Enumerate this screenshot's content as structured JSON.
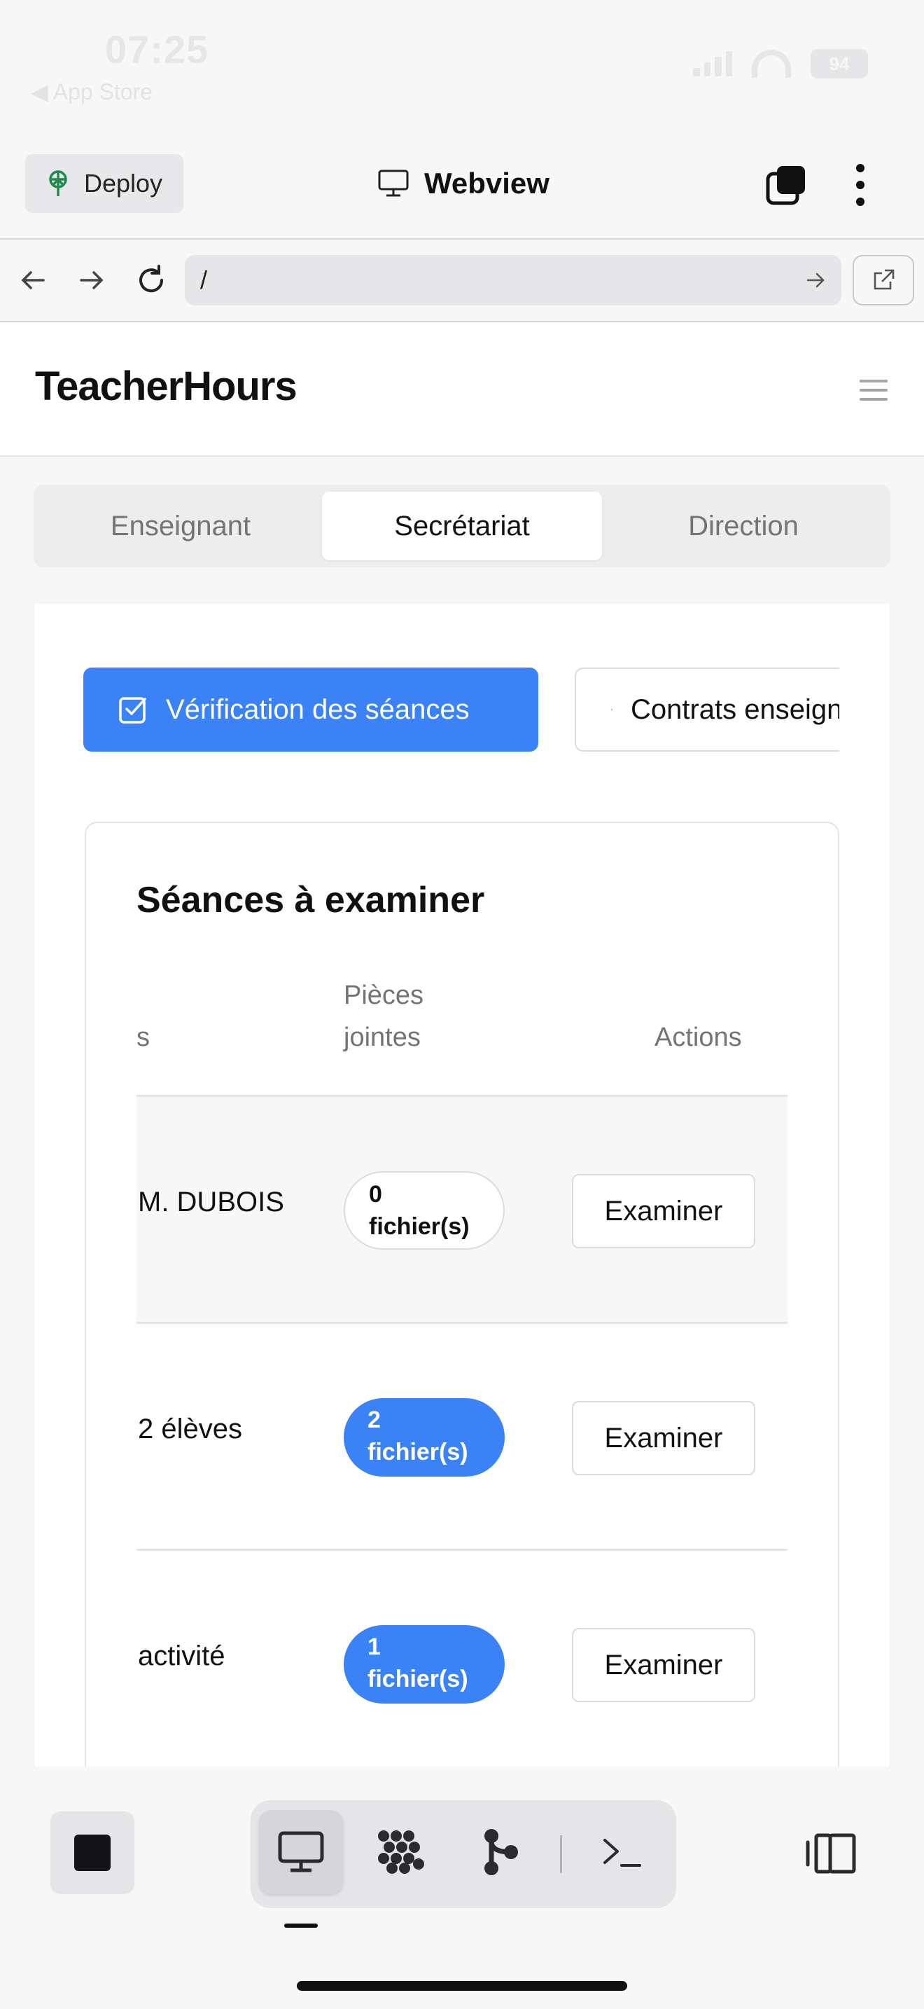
{
  "status_bar": {
    "time": "07:25",
    "back_label": "◀ App Store",
    "battery": "94"
  },
  "replit_bar": {
    "deploy_label": "Deploy",
    "title": "Webview"
  },
  "browser": {
    "url": "/"
  },
  "app": {
    "brand": "TeacherHours",
    "role_tabs": [
      {
        "label": "Enseignant",
        "active": false
      },
      {
        "label": "Secrétariat",
        "active": true
      },
      {
        "label": "Direction",
        "active": false
      }
    ],
    "actions": {
      "verify_label": "Vérification des séances",
      "contracts_label": "Contrats enseignants"
    },
    "sessions": {
      "title": "Séances à examiner",
      "columns": {
        "col_partial": "s",
        "attachments_line1": "Pièces",
        "attachments_line2": "jointes",
        "actions": "Actions"
      },
      "rows": [
        {
          "text": "M. DUBOIS",
          "badge_num": "0",
          "badge_unit": "fichier(s)",
          "badge_style": "zero",
          "action": "Examiner"
        },
        {
          "text": "2 élèves",
          "badge_num": "2",
          "badge_unit": "fichier(s)",
          "badge_style": "blue",
          "action": "Examiner"
        },
        {
          "text": "activité",
          "badge_num": "1",
          "badge_unit": "fichier(s)",
          "badge_style": "blue",
          "action": "Examiner"
        }
      ]
    }
  },
  "colors": {
    "accent": "#3b82f6",
    "background": "#f7f7f8",
    "border": "#e4e4e7"
  },
  "icons": [
    "deploy-icon",
    "monitor-icon",
    "tabs-icon",
    "more-icon",
    "back-icon",
    "forward-icon",
    "reload-icon",
    "url-go-icon",
    "open-external-icon",
    "menu-icon",
    "check-square-icon",
    "file-plus-icon",
    "stop-icon",
    "webview-tool-icon",
    "agent-tool-icon",
    "git-tool-icon",
    "shell-tool-icon",
    "split-view-icon"
  ]
}
